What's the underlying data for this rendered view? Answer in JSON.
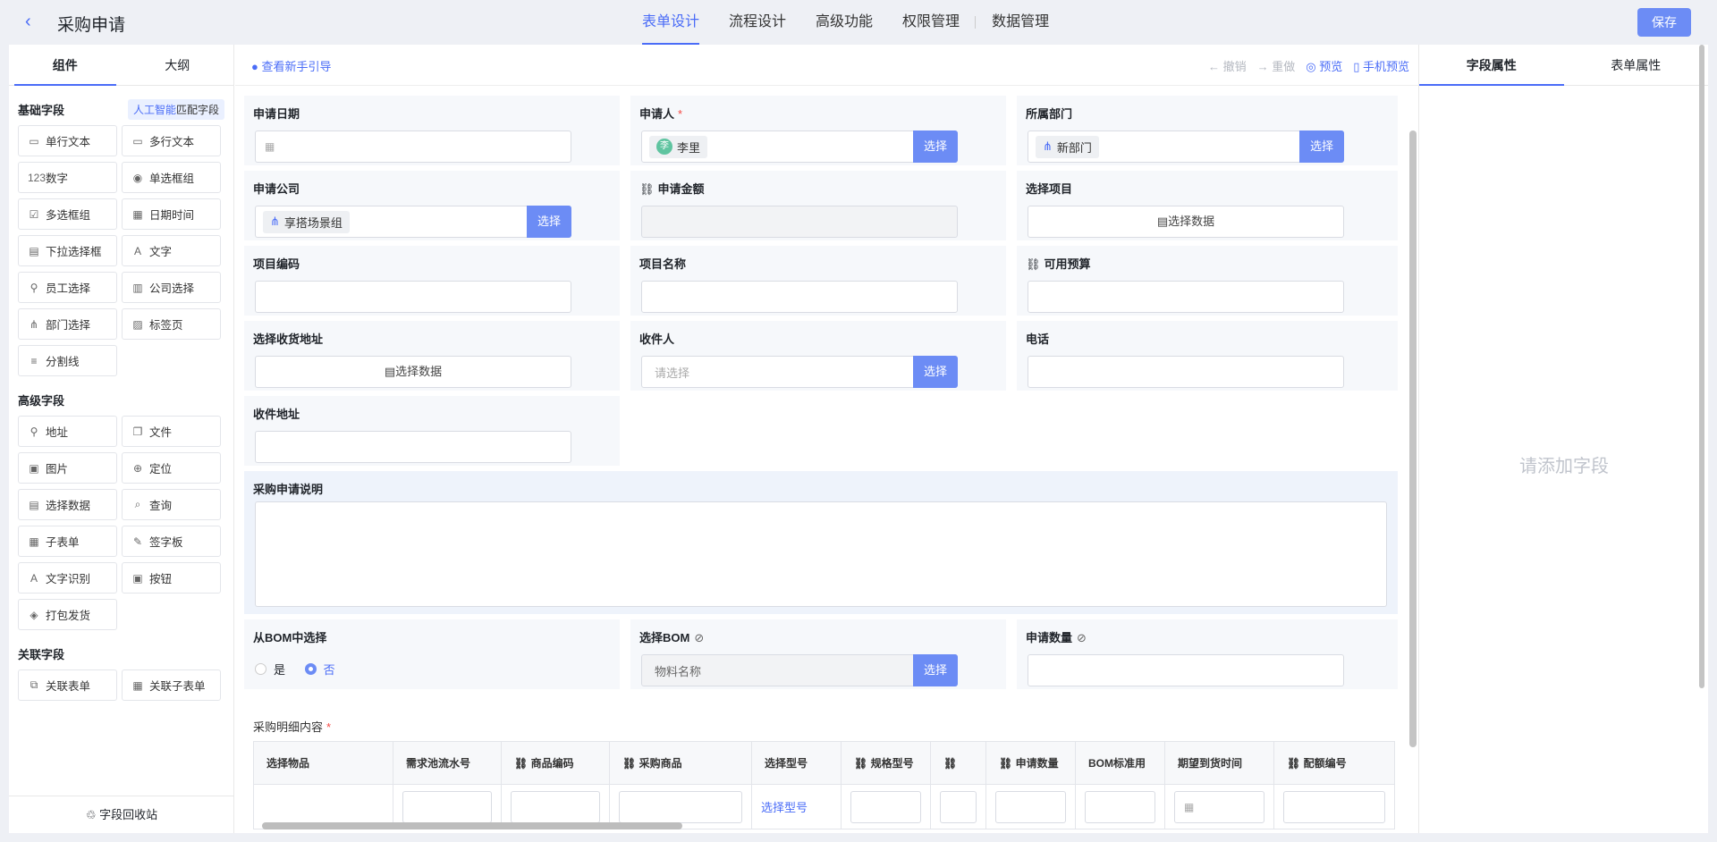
{
  "header": {
    "title": "采购申请",
    "tabs": [
      "表单设计",
      "流程设计",
      "高级功能",
      "权限管理",
      "数据管理"
    ],
    "save": "保存"
  },
  "left": {
    "tabs": [
      "组件",
      "大纲"
    ],
    "basic_title": "基础字段",
    "ai_label": "人工智能",
    "ai_label2": "匹配字段",
    "basic": [
      {
        "icon": "▭",
        "label": "单行文本"
      },
      {
        "icon": "▭",
        "label": "多行文本"
      },
      {
        "icon": "123",
        "label": "数字"
      },
      {
        "icon": "◉",
        "label": "单选框组"
      },
      {
        "icon": "☑",
        "label": "多选框组"
      },
      {
        "icon": "▦",
        "label": "日期时间"
      },
      {
        "icon": "▤",
        "label": "下拉选择框"
      },
      {
        "icon": "A",
        "label": "文字"
      },
      {
        "icon": "⚲",
        "label": "员工选择"
      },
      {
        "icon": "▥",
        "label": "公司选择"
      },
      {
        "icon": "⋔",
        "label": "部门选择"
      },
      {
        "icon": "▨",
        "label": "标签页"
      },
      {
        "icon": "≡",
        "label": "分割线"
      }
    ],
    "advanced_title": "高级字段",
    "advanced": [
      {
        "icon": "⚲",
        "label": "地址"
      },
      {
        "icon": "❐",
        "label": "文件"
      },
      {
        "icon": "▣",
        "label": "图片"
      },
      {
        "icon": "⊕",
        "label": "定位"
      },
      {
        "icon": "▤",
        "label": "选择数据"
      },
      {
        "icon": "⌕",
        "label": "查询"
      },
      {
        "icon": "▦",
        "label": "子表单"
      },
      {
        "icon": "✎",
        "label": "签字板"
      },
      {
        "icon": "A",
        "label": "文字识别"
      },
      {
        "icon": "▣",
        "label": "按钮"
      },
      {
        "icon": "◈",
        "label": "打包发货"
      }
    ],
    "relation_title": "关联字段",
    "relation": [
      {
        "icon": "⧉",
        "label": "关联表单"
      },
      {
        "icon": "▦",
        "label": "关联子表单"
      }
    ],
    "recycle": "字段回收站"
  },
  "toolbar": {
    "guide": "查看新手引导",
    "undo": "撤销",
    "redo": "重做",
    "preview": "预览",
    "mobile": "手机预览"
  },
  "form": {
    "apply_date": "申请日期",
    "applicant": "申请人",
    "applicant_value": "李里",
    "applicant_avatar": "李",
    "dept": "所属部门",
    "dept_value": "新部门",
    "company": "申请公司",
    "company_value": "享搭场景组",
    "amount": "申请金额",
    "project_select": "选择项目",
    "select_data": "选择数据",
    "project_code": "项目编码",
    "project_name": "项目名称",
    "budget": "可用预算",
    "address_select": "选择收货地址",
    "receiver": "收件人",
    "receiver_ph": "请选择",
    "phone": "电话",
    "address": "收件地址",
    "desc": "采购申请说明",
    "from_bom": "从BOM中选择",
    "yes": "是",
    "no": "否",
    "bom_select": "选择BOM",
    "bom_ph": "物料名称",
    "qty": "申请数量",
    "detail": "采购明细内容",
    "select_btn": "选择"
  },
  "table": {
    "headers": [
      "选择物品",
      "需求池流水号",
      "商品编码",
      "采购商品",
      "选择型号",
      "规格型号",
      "",
      "申请数量",
      "BOM标准用",
      "期望到货时间",
      "配额编号"
    ],
    "select_model_link": "选择型号"
  },
  "right": {
    "tabs": [
      "字段属性",
      "表单属性"
    ],
    "empty": "请添加字段"
  }
}
